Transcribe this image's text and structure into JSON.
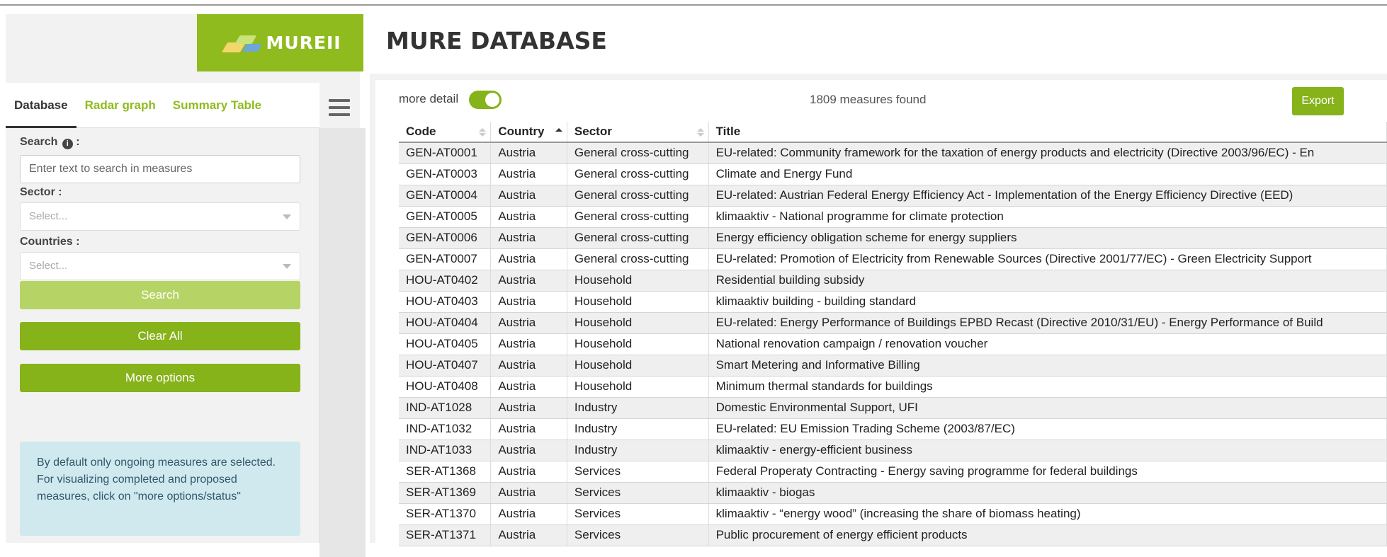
{
  "app": {
    "logo_text": "MUREII",
    "title": "MURE DATABASE"
  },
  "tabs": [
    {
      "label": "Database",
      "active": true
    },
    {
      "label": "Radar graph",
      "active": false
    },
    {
      "label": "Summary Table",
      "active": false
    }
  ],
  "filters": {
    "search_label": "Search",
    "search_placeholder": "Enter text to search in measures",
    "sector_label": "Sector :",
    "sector_placeholder": "Select...",
    "countries_label": "Countries :",
    "countries_placeholder": "Select..."
  },
  "buttons": {
    "search": "Search",
    "clear_all": "Clear All",
    "more_options": "More options",
    "export": "Export"
  },
  "notice": "By default only ongoing measures are selected. For visualizing completed and proposed measures, click on \"more options/status\"",
  "toolbar": {
    "more_detail_label": "more detail",
    "more_detail_on": true,
    "results_text": "1809 measures found"
  },
  "table": {
    "columns": [
      "Code",
      "Country",
      "Sector",
      "Title"
    ],
    "rows": [
      [
        "GEN-AT0001",
        "Austria",
        "General cross-cutting",
        "EU-related: Community framework for the taxation of energy products and electricity (Directive 2003/96/EC) - En"
      ],
      [
        "GEN-AT0003",
        "Austria",
        "General cross-cutting",
        "Climate and Energy Fund"
      ],
      [
        "GEN-AT0004",
        "Austria",
        "General cross-cutting",
        "EU-related: Austrian Federal Energy Efficiency Act - Implementation of the Energy Efficiency Directive (EED)"
      ],
      [
        "GEN-AT0005",
        "Austria",
        "General cross-cutting",
        "klimaaktiv - National programme for climate protection"
      ],
      [
        "GEN-AT0006",
        "Austria",
        "General cross-cutting",
        "Energy efficiency obligation scheme for energy suppliers"
      ],
      [
        "GEN-AT0007",
        "Austria",
        "General cross-cutting",
        "EU-related: Promotion of Electricity from Renewable Sources (Directive 2001/77/EC) - Green Electricity Support"
      ],
      [
        "HOU-AT0402",
        "Austria",
        "Household",
        "Residential building subsidy"
      ],
      [
        "HOU-AT0403",
        "Austria",
        "Household",
        "klimaaktiv building - building standard"
      ],
      [
        "HOU-AT0404",
        "Austria",
        "Household",
        "EU-related: Energy Performance of Buildings EPBD Recast (Directive 2010/31/EU) - Energy Performance of Build"
      ],
      [
        "HOU-AT0405",
        "Austria",
        "Household",
        "National renovation campaign / renovation voucher"
      ],
      [
        "HOU-AT0407",
        "Austria",
        "Household",
        "Smart Metering and Informative Billing"
      ],
      [
        "HOU-AT0408",
        "Austria",
        "Household",
        "Minimum thermal standards for buildings"
      ],
      [
        "IND-AT1028",
        "Austria",
        "Industry",
        "Domestic Environmental Support, UFI"
      ],
      [
        "IND-AT1032",
        "Austria",
        "Industry",
        "EU-related: EU Emission Trading Scheme (2003/87/EC)"
      ],
      [
        "IND-AT1033",
        "Austria",
        "Industry",
        "klimaaktiv - energy-efficient business"
      ],
      [
        "SER-AT1368",
        "Austria",
        "Services",
        "Federal Properaty Contracting - Energy saving programme for federal buildings"
      ],
      [
        "SER-AT1369",
        "Austria",
        "Services",
        "klimaaktiv - biogas"
      ],
      [
        "SER-AT1370",
        "Austria",
        "Services",
        "klimaaktiv - “energy wood” (increasing the share of biomass heating)"
      ],
      [
        "SER-AT1371",
        "Austria",
        "Services",
        "Public procurement of energy efficient products"
      ]
    ]
  },
  "colors": {
    "brand_green": "#86b21a",
    "light_green": "#b6d465",
    "notice_bg": "#cfe9ef"
  }
}
